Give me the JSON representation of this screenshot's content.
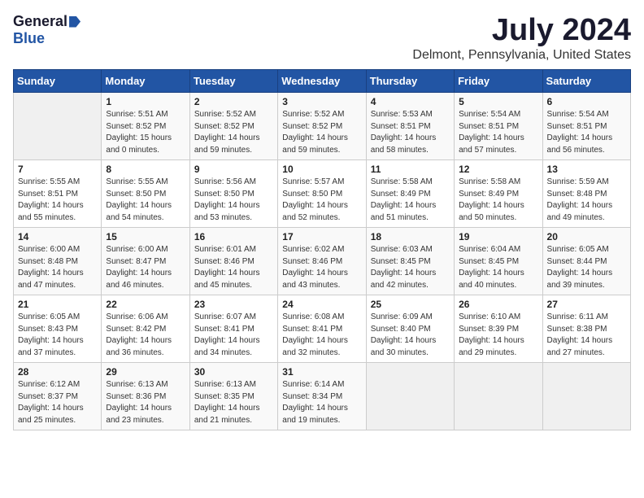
{
  "header": {
    "logo_general": "General",
    "logo_blue": "Blue",
    "month_year": "July 2024",
    "location": "Delmont, Pennsylvania, United States"
  },
  "days_of_week": [
    "Sunday",
    "Monday",
    "Tuesday",
    "Wednesday",
    "Thursday",
    "Friday",
    "Saturday"
  ],
  "weeks": [
    [
      {
        "day": "",
        "empty": true
      },
      {
        "day": "1",
        "sunrise": "5:51 AM",
        "sunset": "8:52 PM",
        "daylight": "15 hours and 0 minutes."
      },
      {
        "day": "2",
        "sunrise": "5:52 AM",
        "sunset": "8:52 PM",
        "daylight": "14 hours and 59 minutes."
      },
      {
        "day": "3",
        "sunrise": "5:52 AM",
        "sunset": "8:52 PM",
        "daylight": "14 hours and 59 minutes."
      },
      {
        "day": "4",
        "sunrise": "5:53 AM",
        "sunset": "8:51 PM",
        "daylight": "14 hours and 58 minutes."
      },
      {
        "day": "5",
        "sunrise": "5:54 AM",
        "sunset": "8:51 PM",
        "daylight": "14 hours and 57 minutes."
      },
      {
        "day": "6",
        "sunrise": "5:54 AM",
        "sunset": "8:51 PM",
        "daylight": "14 hours and 56 minutes."
      }
    ],
    [
      {
        "day": "7",
        "sunrise": "5:55 AM",
        "sunset": "8:51 PM",
        "daylight": "14 hours and 55 minutes."
      },
      {
        "day": "8",
        "sunrise": "5:55 AM",
        "sunset": "8:50 PM",
        "daylight": "14 hours and 54 minutes."
      },
      {
        "day": "9",
        "sunrise": "5:56 AM",
        "sunset": "8:50 PM",
        "daylight": "14 hours and 53 minutes."
      },
      {
        "day": "10",
        "sunrise": "5:57 AM",
        "sunset": "8:50 PM",
        "daylight": "14 hours and 52 minutes."
      },
      {
        "day": "11",
        "sunrise": "5:58 AM",
        "sunset": "8:49 PM",
        "daylight": "14 hours and 51 minutes."
      },
      {
        "day": "12",
        "sunrise": "5:58 AM",
        "sunset": "8:49 PM",
        "daylight": "14 hours and 50 minutes."
      },
      {
        "day": "13",
        "sunrise": "5:59 AM",
        "sunset": "8:48 PM",
        "daylight": "14 hours and 49 minutes."
      }
    ],
    [
      {
        "day": "14",
        "sunrise": "6:00 AM",
        "sunset": "8:48 PM",
        "daylight": "14 hours and 47 minutes."
      },
      {
        "day": "15",
        "sunrise": "6:00 AM",
        "sunset": "8:47 PM",
        "daylight": "14 hours and 46 minutes."
      },
      {
        "day": "16",
        "sunrise": "6:01 AM",
        "sunset": "8:46 PM",
        "daylight": "14 hours and 45 minutes."
      },
      {
        "day": "17",
        "sunrise": "6:02 AM",
        "sunset": "8:46 PM",
        "daylight": "14 hours and 43 minutes."
      },
      {
        "day": "18",
        "sunrise": "6:03 AM",
        "sunset": "8:45 PM",
        "daylight": "14 hours and 42 minutes."
      },
      {
        "day": "19",
        "sunrise": "6:04 AM",
        "sunset": "8:45 PM",
        "daylight": "14 hours and 40 minutes."
      },
      {
        "day": "20",
        "sunrise": "6:05 AM",
        "sunset": "8:44 PM",
        "daylight": "14 hours and 39 minutes."
      }
    ],
    [
      {
        "day": "21",
        "sunrise": "6:05 AM",
        "sunset": "8:43 PM",
        "daylight": "14 hours and 37 minutes."
      },
      {
        "day": "22",
        "sunrise": "6:06 AM",
        "sunset": "8:42 PM",
        "daylight": "14 hours and 36 minutes."
      },
      {
        "day": "23",
        "sunrise": "6:07 AM",
        "sunset": "8:41 PM",
        "daylight": "14 hours and 34 minutes."
      },
      {
        "day": "24",
        "sunrise": "6:08 AM",
        "sunset": "8:41 PM",
        "daylight": "14 hours and 32 minutes."
      },
      {
        "day": "25",
        "sunrise": "6:09 AM",
        "sunset": "8:40 PM",
        "daylight": "14 hours and 30 minutes."
      },
      {
        "day": "26",
        "sunrise": "6:10 AM",
        "sunset": "8:39 PM",
        "daylight": "14 hours and 29 minutes."
      },
      {
        "day": "27",
        "sunrise": "6:11 AM",
        "sunset": "8:38 PM",
        "daylight": "14 hours and 27 minutes."
      }
    ],
    [
      {
        "day": "28",
        "sunrise": "6:12 AM",
        "sunset": "8:37 PM",
        "daylight": "14 hours and 25 minutes."
      },
      {
        "day": "29",
        "sunrise": "6:13 AM",
        "sunset": "8:36 PM",
        "daylight": "14 hours and 23 minutes."
      },
      {
        "day": "30",
        "sunrise": "6:13 AM",
        "sunset": "8:35 PM",
        "daylight": "14 hours and 21 minutes."
      },
      {
        "day": "31",
        "sunrise": "6:14 AM",
        "sunset": "8:34 PM",
        "daylight": "14 hours and 19 minutes."
      },
      {
        "day": "",
        "empty": true
      },
      {
        "day": "",
        "empty": true
      },
      {
        "day": "",
        "empty": true
      }
    ]
  ]
}
